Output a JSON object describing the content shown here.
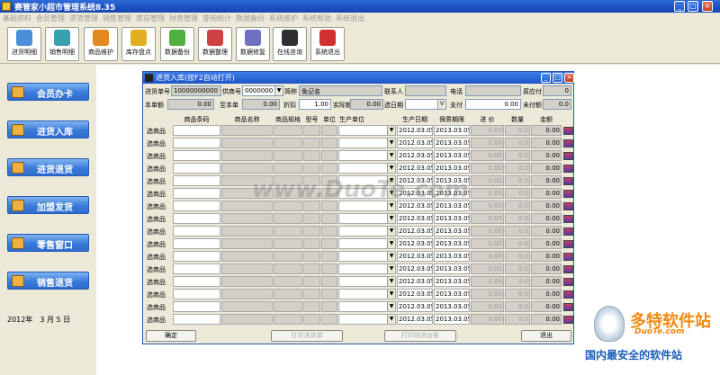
{
  "app": {
    "title": "赛管家小超市管理系统8.35",
    "min": "_",
    "max": "□",
    "close": "×"
  },
  "menu": [
    "基础资料",
    "会员管理",
    "进货管理",
    "销售管理",
    "库存管理",
    "财务管理",
    "查询统计",
    "数据备份",
    "系统维护",
    "系统帮助",
    "系统退出"
  ],
  "toolbar": [
    {
      "label": "进货明细",
      "icon": "pen-icon",
      "color": "#4a90d9"
    },
    {
      "label": "销售明细",
      "icon": "box-icon",
      "color": "#3aa0b0"
    },
    {
      "label": "商品维护",
      "icon": "brush-icon",
      "color": "#e08a20"
    },
    {
      "label": "库存盘点",
      "icon": "pencil-icon",
      "color": "#e0b020"
    },
    {
      "label": "数据备份",
      "icon": "plant-icon",
      "color": "#50b040"
    },
    {
      "label": "数据整理",
      "icon": "pie-chart-icon",
      "color": "#d04040"
    },
    {
      "label": "数据修复",
      "icon": "hammer-icon",
      "color": "#7070c0"
    },
    {
      "label": "在线咨询",
      "icon": "headset-icon",
      "color": "#303030"
    },
    {
      "label": "系统退出",
      "icon": "power-icon",
      "color": "#d03030"
    }
  ],
  "nav": [
    {
      "label": "会员办卡",
      "icon": "member-card-icon"
    },
    {
      "label": "进货入库",
      "icon": "stock-in-icon"
    },
    {
      "label": "进货退货",
      "icon": "stock-return-icon"
    },
    {
      "label": "加盟发货",
      "icon": "franchise-ship-icon"
    },
    {
      "label": "零售窗口",
      "icon": "retail-window-icon"
    },
    {
      "label": "销售退货",
      "icon": "sales-return-icon"
    }
  ],
  "date": "2012年　3 月 5 日",
  "child": {
    "title": "进货入库(按F2自动打开)",
    "fields": {
      "order_no_label": "进货单号",
      "order_no": "10000000000",
      "supplier_no_label": "供商号",
      "supplier_no": "0000000",
      "short_name_label": "简称",
      "short_name": "免记名",
      "contact_label": "联系人",
      "contact": "",
      "phone_label": "电话",
      "phone": "",
      "orig_payable_label": "原应付",
      "orig_payable": "0",
      "this_amount_label": "本单额",
      "this_amount": "0.00",
      "up_to_label": "至本单",
      "up_to": "0.00",
      "discount_label": "折扣",
      "discount": "1.00",
      "actual_label": "实际额",
      "actual": "0.00",
      "sel_date_label": "选日期",
      "sel_date": "",
      "pay_label": "支付",
      "pay": "0.00",
      "unpaid_label": "未付额",
      "unpaid": "0.0"
    },
    "columns": [
      "商品条码",
      "商品名称",
      "商品规格",
      "型号",
      "单位",
      "生产单位",
      "生产日期",
      "保质期限",
      "进 价",
      "数量",
      "金额"
    ],
    "row_label": "选商品",
    "prod_date": "2012.03.05",
    "expire_date": "2013.03.05",
    "price": "0.00",
    "qty": "0.0",
    "amount": "0.00",
    "buttons": {
      "confirm": "确定",
      "print_order": "打印进货单",
      "print_label": "打印进货台账",
      "exit": "退出"
    }
  },
  "watermark": "www.DuoTe.com",
  "logo": {
    "text": "多特软件站",
    "url": "DuoTe.com",
    "tag": "国内最安全的软件站"
  }
}
